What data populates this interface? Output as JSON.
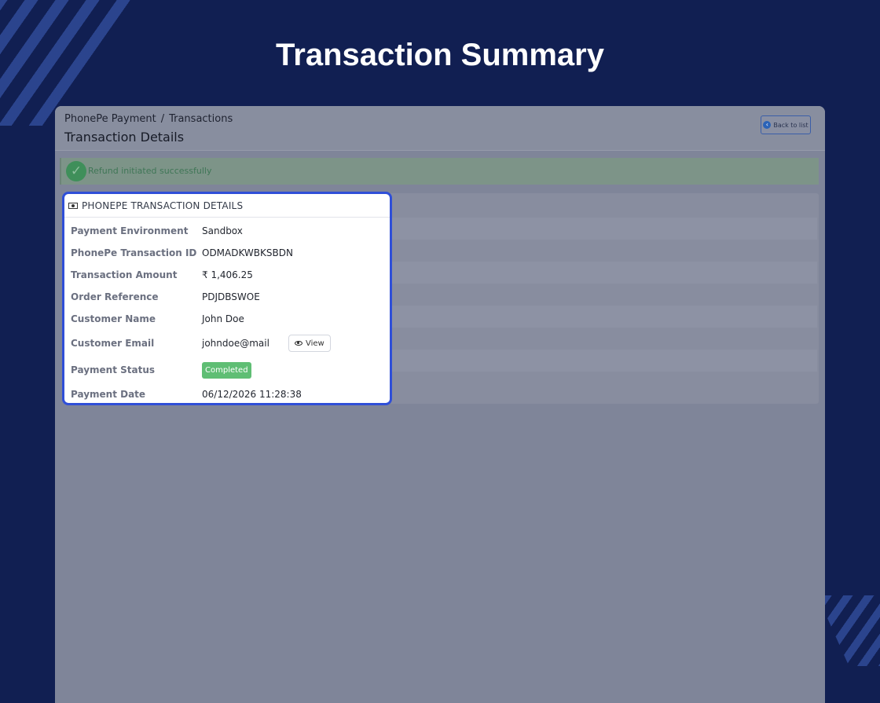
{
  "hero": {
    "title": "Transaction Summary"
  },
  "breadcrumb": {
    "items": [
      "PhonePe Payment",
      "Transactions"
    ],
    "separator": "/"
  },
  "page": {
    "title": "Transaction Details"
  },
  "toolbar": {
    "back_label": "Back to list",
    "back_icon": "arrow-left-circle-icon"
  },
  "alert": {
    "message": "Refund initiated successfully",
    "icon": "check-circle-icon"
  },
  "card": {
    "title": "PHONEPE TRANSACTION DETAILS",
    "icon": "cash-icon",
    "fields": [
      {
        "label": "Payment Environment",
        "value": "Sandbox"
      },
      {
        "label": "PhonePe Transaction ID",
        "value": "ODMADKWBKSBDN"
      },
      {
        "label": "Transaction Amount",
        "value": "₹ 1,406.25"
      },
      {
        "label": "Order Reference",
        "value": "PDJDBSWOE"
      },
      {
        "label": "Customer Name",
        "value": "John Doe"
      },
      {
        "label": "Customer Email",
        "value": "johndoe@mail",
        "action_label": "View",
        "action_icon": "eye-icon"
      },
      {
        "label": "Payment Status",
        "value": "Completed",
        "badge_color": "#5fbe74"
      },
      {
        "label": "Payment Date",
        "value": "06/12/2026 11:28:38"
      }
    ]
  },
  "colors": {
    "background": "#111f52",
    "highlight_border": "#2f4fd8",
    "success_badge": "#5fbe74"
  }
}
